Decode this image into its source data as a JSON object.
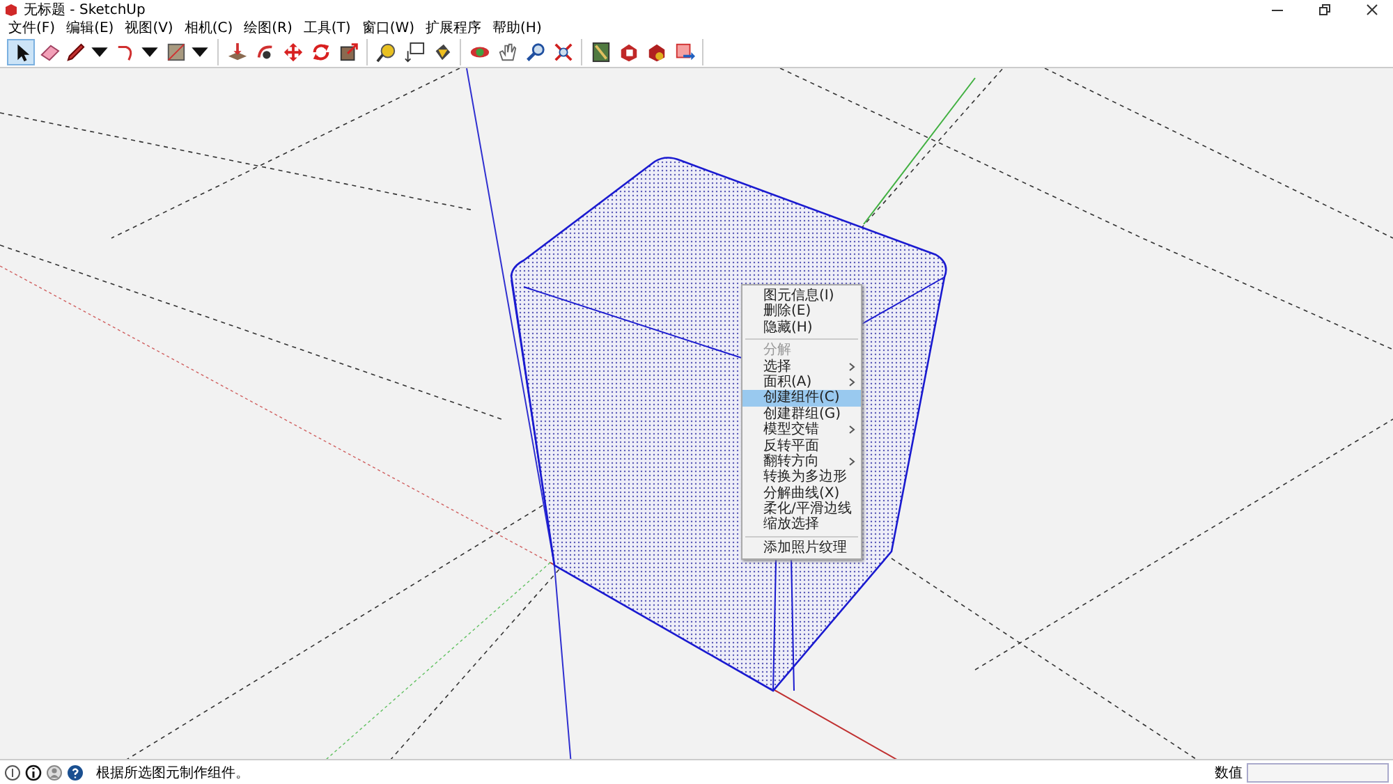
{
  "window": {
    "title": "无标题 - SketchUp"
  },
  "menu_bar": [
    "文件(F)",
    "编辑(E)",
    "视图(V)",
    "相机(C)",
    "绘图(R)",
    "工具(T)",
    "窗口(W)",
    "扩展程序",
    "帮助(H)"
  ],
  "toolbar": [
    [
      {
        "kind": "select",
        "selected": true,
        "dropdown": false
      },
      {
        "kind": "eraser",
        "selected": false,
        "dropdown": false
      },
      {
        "kind": "pencil",
        "selected": false,
        "dropdown": true
      },
      {
        "kind": "arc",
        "selected": false,
        "dropdown": true
      },
      {
        "kind": "rectangle",
        "selected": false,
        "dropdown": true
      }
    ],
    [
      {
        "kind": "pushpull",
        "selected": false,
        "dropdown": false
      },
      {
        "kind": "followme",
        "selected": false,
        "dropdown": false
      },
      {
        "kind": "move",
        "selected": false,
        "dropdown": false
      },
      {
        "kind": "rotate",
        "selected": false,
        "dropdown": false
      },
      {
        "kind": "scale",
        "selected": false,
        "dropdown": false
      }
    ],
    [
      {
        "kind": "tape",
        "selected": false,
        "dropdown": false
      },
      {
        "kind": "text",
        "selected": false,
        "dropdown": false
      },
      {
        "kind": "paint",
        "selected": false,
        "dropdown": false
      }
    ],
    [
      {
        "kind": "orbit",
        "selected": false,
        "dropdown": false
      },
      {
        "kind": "pan",
        "selected": false,
        "dropdown": false
      },
      {
        "kind": "zoom",
        "selected": false,
        "dropdown": false
      },
      {
        "kind": "zoomext",
        "selected": false,
        "dropdown": false
      }
    ],
    [
      {
        "kind": "warehouse",
        "selected": false,
        "dropdown": false
      },
      {
        "kind": "share",
        "selected": false,
        "dropdown": false
      },
      {
        "kind": "extension",
        "selected": false,
        "dropdown": false
      },
      {
        "kind": "send",
        "selected": false,
        "dropdown": false
      }
    ]
  ],
  "context_menu": [
    {
      "kind": "item",
      "label": "图元信息(I)",
      "disabled": false,
      "submenu": false,
      "selected": false
    },
    {
      "kind": "item",
      "label": "删除(E)",
      "disabled": false,
      "submenu": false,
      "selected": false
    },
    {
      "kind": "item",
      "label": "隐藏(H)",
      "disabled": false,
      "submenu": false,
      "selected": false
    },
    {
      "kind": "separator"
    },
    {
      "kind": "item",
      "label": "分解",
      "disabled": true,
      "submenu": false,
      "selected": false
    },
    {
      "kind": "item",
      "label": "选择",
      "disabled": false,
      "submenu": true,
      "selected": false
    },
    {
      "kind": "item",
      "label": "面积(A)",
      "disabled": false,
      "submenu": true,
      "selected": false
    },
    {
      "kind": "item",
      "label": "创建组件(C)",
      "disabled": false,
      "submenu": false,
      "selected": true
    },
    {
      "kind": "item",
      "label": "创建群组(G)",
      "disabled": false,
      "submenu": false,
      "selected": false
    },
    {
      "kind": "item",
      "label": "模型交错",
      "disabled": false,
      "submenu": true,
      "selected": false
    },
    {
      "kind": "item",
      "label": "反转平面",
      "disabled": false,
      "submenu": false,
      "selected": false
    },
    {
      "kind": "item",
      "label": "翻转方向",
      "disabled": false,
      "submenu": true,
      "selected": false
    },
    {
      "kind": "item",
      "label": "转换为多边形",
      "disabled": false,
      "submenu": false,
      "selected": false
    },
    {
      "kind": "item",
      "label": "分解曲线(X)",
      "disabled": false,
      "submenu": false,
      "selected": false
    },
    {
      "kind": "item",
      "label": "柔化/平滑边线",
      "disabled": false,
      "submenu": false,
      "selected": false
    },
    {
      "kind": "item",
      "label": "缩放选择",
      "disabled": false,
      "submenu": false,
      "selected": false
    },
    {
      "kind": "separator"
    },
    {
      "kind": "item",
      "label": "添加照片纹理",
      "disabled": false,
      "submenu": false,
      "selected": false
    }
  ],
  "status_bar": {
    "message": "根据所选图元制作组件。",
    "measurement_label": "数值"
  }
}
